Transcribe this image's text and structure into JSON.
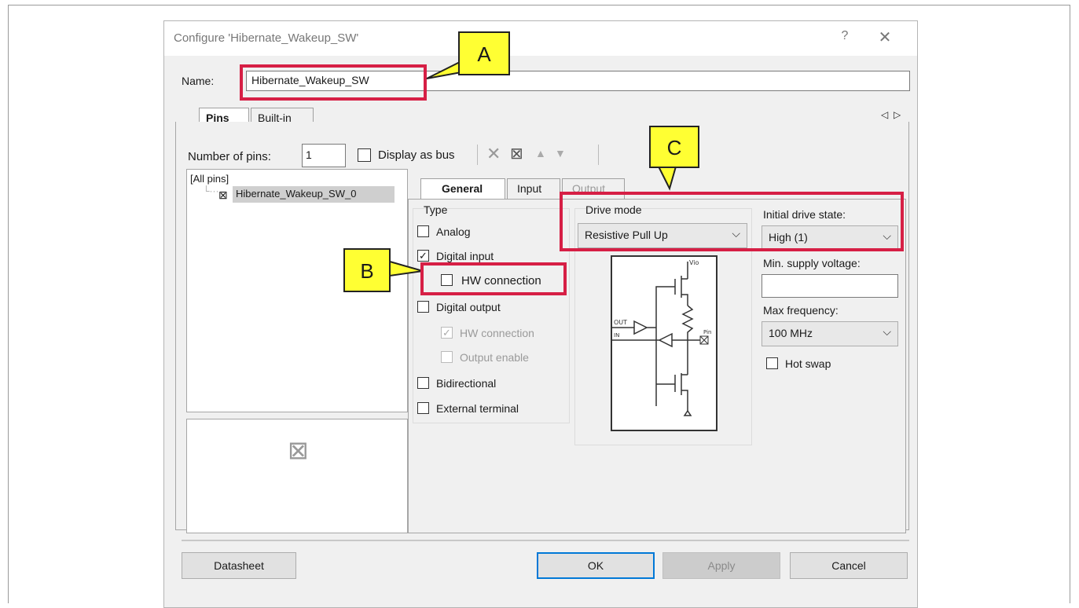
{
  "dialog": {
    "title": "Configure 'Hibernate_Wakeup_SW'",
    "help_glyph": "?",
    "close_glyph": "✕"
  },
  "name": {
    "label": "Name:",
    "value": "Hibernate_Wakeup_SW"
  },
  "outer_tabs": [
    {
      "label": "Pins",
      "active": true
    },
    {
      "label": "Built-in",
      "active": false
    }
  ],
  "tab_scroll": {
    "left": "◁",
    "right": "▷"
  },
  "toolbar": {
    "number_of_pins_label": "Number of pins:",
    "number_of_pins_value": "1",
    "display_as_bus_label": "Display as bus"
  },
  "pin_tree": {
    "root": "[All pins]",
    "items": [
      "Hibernate_Wakeup_SW_0"
    ]
  },
  "inner_tabs": [
    {
      "label": "General",
      "active": true
    },
    {
      "label": "Input",
      "active": false
    },
    {
      "label": "Output",
      "active": false,
      "disabled": true
    }
  ],
  "type_group": {
    "title": "Type",
    "analog": "Analog",
    "digital_input": "Digital input",
    "hw_connection": "HW connection",
    "digital_output": "Digital output",
    "out_hw_connection": "HW connection",
    "output_enable": "Output enable",
    "bidirectional": "Bidirectional",
    "external_terminal": "External terminal"
  },
  "drive": {
    "title": "Drive mode",
    "selected": "Resistive Pull Up",
    "schem_vio": "Vio",
    "schem_out": "OUT",
    "schem_in": "IN",
    "schem_pin": "Pin"
  },
  "right_fields": {
    "initial_drive_state_label": "Initial drive state:",
    "initial_drive_state_value": "High (1)",
    "min_supply_label": "Min. supply voltage:",
    "min_supply_value": "",
    "max_frequency_label": "Max frequency:",
    "max_frequency_value": "100 MHz",
    "hot_swap_label": "Hot swap"
  },
  "buttons": {
    "datasheet": "Datasheet",
    "ok": "OK",
    "apply": "Apply",
    "cancel": "Cancel"
  },
  "callouts": {
    "a": "A",
    "b": "B",
    "c": "C"
  },
  "colors": {
    "highlight": "#d61f45",
    "callout_fill": "#ffff33",
    "focus_blue": "#0078d7"
  }
}
